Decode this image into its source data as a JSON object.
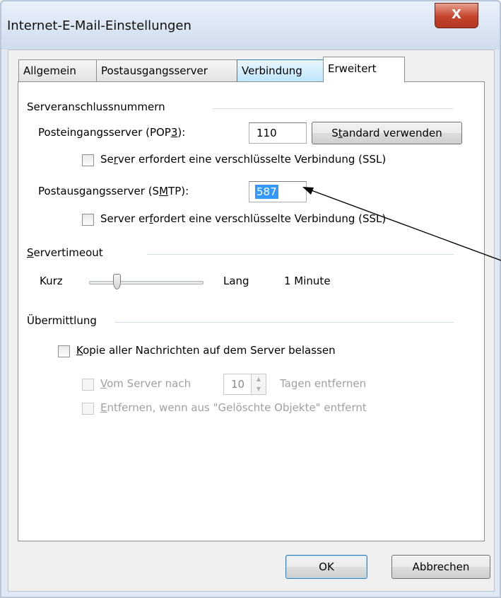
{
  "window": {
    "title": "Internet-E-Mail-Einstellungen",
    "close_glyph": "X"
  },
  "tabs": [
    {
      "label": "Allgemein"
    },
    {
      "label": "Postausgangsserver"
    },
    {
      "label": "Verbindung"
    },
    {
      "label": "Erweitert"
    }
  ],
  "ports_group": {
    "heading": "Serveranschlussnummern",
    "pop3_label_before": "Posteingangsserver (POP",
    "pop3_label_u": "3",
    "pop3_label_after": "):",
    "pop3_value": "110",
    "standard_button_before": "S",
    "standard_button_u": "t",
    "standard_button_after": "andard verwenden",
    "pop3_ssl_before": "Se",
    "pop3_ssl_u": "r",
    "pop3_ssl_after": "ver erfordert eine verschlüsselte Verbindung (SSL)",
    "smtp_label_before": "Postausgangsserver (S",
    "smtp_label_u": "M",
    "smtp_label_after": "TP):",
    "smtp_value": "587",
    "smtp_ssl_before": "Server er",
    "smtp_ssl_u": "f",
    "smtp_ssl_after": "ordert eine verschlüsselte Verbindung (SSL)"
  },
  "timeout_group": {
    "heading_u": "S",
    "heading_rest": "ervertimeout",
    "short_label": "Kurz",
    "long_label": "Lang",
    "value_text": "1 Minute",
    "slider_level": 0.1
  },
  "delivery_group": {
    "heading": "Übermittlung",
    "keep_copy_u": "K",
    "keep_copy_rest": "opie aller Nachrichten auf dem Server belassen",
    "remove_after_u": "V",
    "remove_after_rest": "om Server nach",
    "days_value": "10",
    "days_suffix": "Tagen entfernen",
    "remove_deleted_u": "E",
    "remove_deleted_rest": "ntfernen, wenn aus \"Gelöschte Objekte\" entfernt"
  },
  "buttons": {
    "ok": "OK",
    "cancel": "Abbrechen"
  },
  "colors": {
    "selection": "#3399ff",
    "close_button": "#c4432c"
  }
}
